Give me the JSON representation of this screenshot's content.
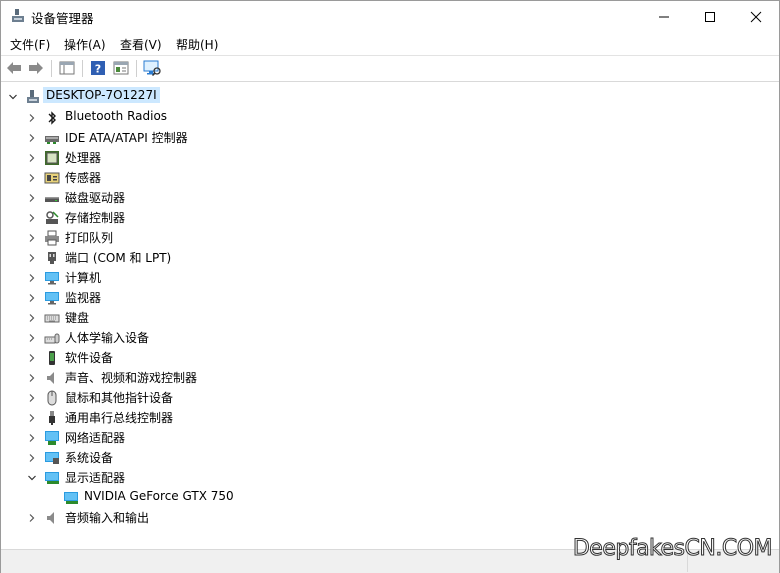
{
  "window": {
    "title": "设备管理器"
  },
  "menu": [
    "文件(F)",
    "操作(A)",
    "查看(V)",
    "帮助(H)"
  ],
  "tree": {
    "root": "DESKTOP-7O1227I",
    "items": [
      {
        "label": "Bluetooth Radios",
        "icon": "bluetooth-icon"
      },
      {
        "label": "IDE ATA/ATAPI 控制器",
        "icon": "ide-controller-icon"
      },
      {
        "label": "处理器",
        "icon": "processor-icon"
      },
      {
        "label": "传感器",
        "icon": "sensor-icon"
      },
      {
        "label": "磁盘驱动器",
        "icon": "disk-drive-icon"
      },
      {
        "label": "存储控制器",
        "icon": "storage-controller-icon"
      },
      {
        "label": "打印队列",
        "icon": "printer-icon"
      },
      {
        "label": "端口 (COM 和 LPT)",
        "icon": "port-icon"
      },
      {
        "label": "计算机",
        "icon": "computer-icon"
      },
      {
        "label": "监视器",
        "icon": "monitor-icon"
      },
      {
        "label": "键盘",
        "icon": "keyboard-icon"
      },
      {
        "label": "人体学输入设备",
        "icon": "hid-icon"
      },
      {
        "label": "软件设备",
        "icon": "software-device-icon"
      },
      {
        "label": "声音、视频和游戏控制器",
        "icon": "sound-icon"
      },
      {
        "label": "鼠标和其他指针设备",
        "icon": "mouse-icon"
      },
      {
        "label": "通用串行总线控制器",
        "icon": "usb-icon"
      },
      {
        "label": "网络适配器",
        "icon": "network-adapter-icon"
      },
      {
        "label": "系统设备",
        "icon": "system-device-icon"
      },
      {
        "label": "显示适配器",
        "icon": "display-adapter-icon",
        "expanded": true
      },
      {
        "label": "NVIDIA GeForce GTX 750",
        "icon": "display-adapter-icon",
        "child": true
      },
      {
        "label": "音频输入和输出",
        "icon": "audio-io-icon"
      }
    ]
  },
  "watermark": "DeepfakesCN.COM",
  "colors": {
    "selection": "#cce8ff",
    "accent": "#1e78d6"
  }
}
